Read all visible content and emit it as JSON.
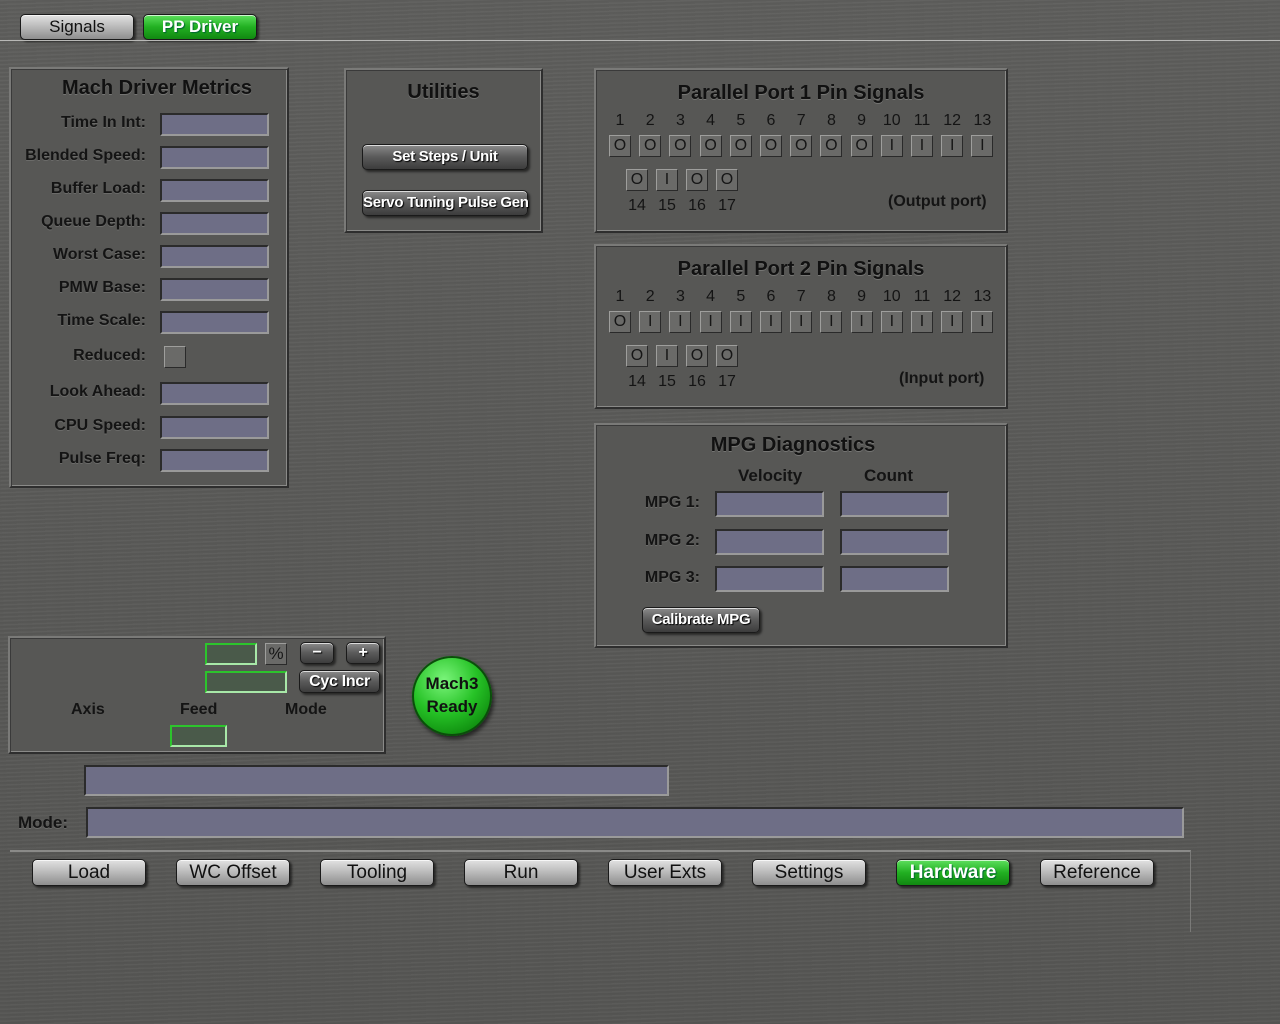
{
  "top_tabs": [
    {
      "label": "Signals",
      "active": false
    },
    {
      "label": "PP Driver",
      "active": true
    }
  ],
  "metrics": {
    "title": "Mach Driver Metrics",
    "fields": [
      {
        "label": "Time In Int:"
      },
      {
        "label": "Blended Speed:"
      },
      {
        "label": "Buffer Load:"
      },
      {
        "label": "Queue Depth:"
      },
      {
        "label": "Worst Case:"
      },
      {
        "label": "PMW Base:"
      },
      {
        "label": "Time Scale:"
      },
      {
        "label": "Reduced:"
      },
      {
        "label": "Look Ahead:"
      },
      {
        "label": "CPU Speed:"
      },
      {
        "label": "Pulse Freq:"
      }
    ]
  },
  "utilities": {
    "title": "Utilities",
    "set_steps": "Set Steps / Unit",
    "servo_tuning": "Servo Tuning Pulse Gen"
  },
  "pp1": {
    "title": "Parallel Port 1 Pin Signals",
    "pins_top": [
      "1",
      "2",
      "3",
      "4",
      "5",
      "6",
      "7",
      "8",
      "9",
      "10",
      "11",
      "12",
      "13"
    ],
    "states_top": [
      "O",
      "O",
      "O",
      "O",
      "O",
      "O",
      "O",
      "O",
      "O",
      "I",
      "I",
      "I",
      "I"
    ],
    "pins_bottom": [
      "14",
      "15",
      "16",
      "17"
    ],
    "states_bottom": [
      "O",
      "I",
      "O",
      "O"
    ],
    "note": "(Output port)"
  },
  "pp2": {
    "title": "Parallel Port 2 Pin Signals",
    "pins_top": [
      "1",
      "2",
      "3",
      "4",
      "5",
      "6",
      "7",
      "8",
      "9",
      "10",
      "11",
      "12",
      "13"
    ],
    "states_top": [
      "O",
      "I",
      "I",
      "I",
      "I",
      "I",
      "I",
      "I",
      "I",
      "I",
      "I",
      "I",
      "I"
    ],
    "pins_bottom": [
      "14",
      "15",
      "16",
      "17"
    ],
    "states_bottom": [
      "O",
      "I",
      "O",
      "O"
    ],
    "note": "(Input port)"
  },
  "mpg": {
    "title": "MPG Diagnostics",
    "col_velocity": "Velocity",
    "col_count": "Count",
    "rows": [
      {
        "label": "MPG 1:"
      },
      {
        "label": "MPG 2:"
      },
      {
        "label": "MPG 3:"
      }
    ],
    "calibrate": "Calibrate MPG"
  },
  "jog": {
    "percent_label": "%",
    "minus_label": "−",
    "plus_label": "+",
    "cyc_incr_label": "Cyc Incr",
    "axis_label": "Axis",
    "feed_label": "Feed",
    "mode_label": "Mode"
  },
  "status_button": {
    "line1": "Mach3",
    "line2": "Ready"
  },
  "status_bar": {
    "mode_label": "Mode:"
  },
  "bottom_tabs": [
    {
      "label": "Load",
      "active": false
    },
    {
      "label": "WC Offset",
      "active": false
    },
    {
      "label": "Tooling",
      "active": false
    },
    {
      "label": "Run",
      "active": false
    },
    {
      "label": "User Exts",
      "active": false
    },
    {
      "label": "Settings",
      "active": false
    },
    {
      "label": "Hardware",
      "active": true
    },
    {
      "label": "Reference",
      "active": false
    }
  ]
}
